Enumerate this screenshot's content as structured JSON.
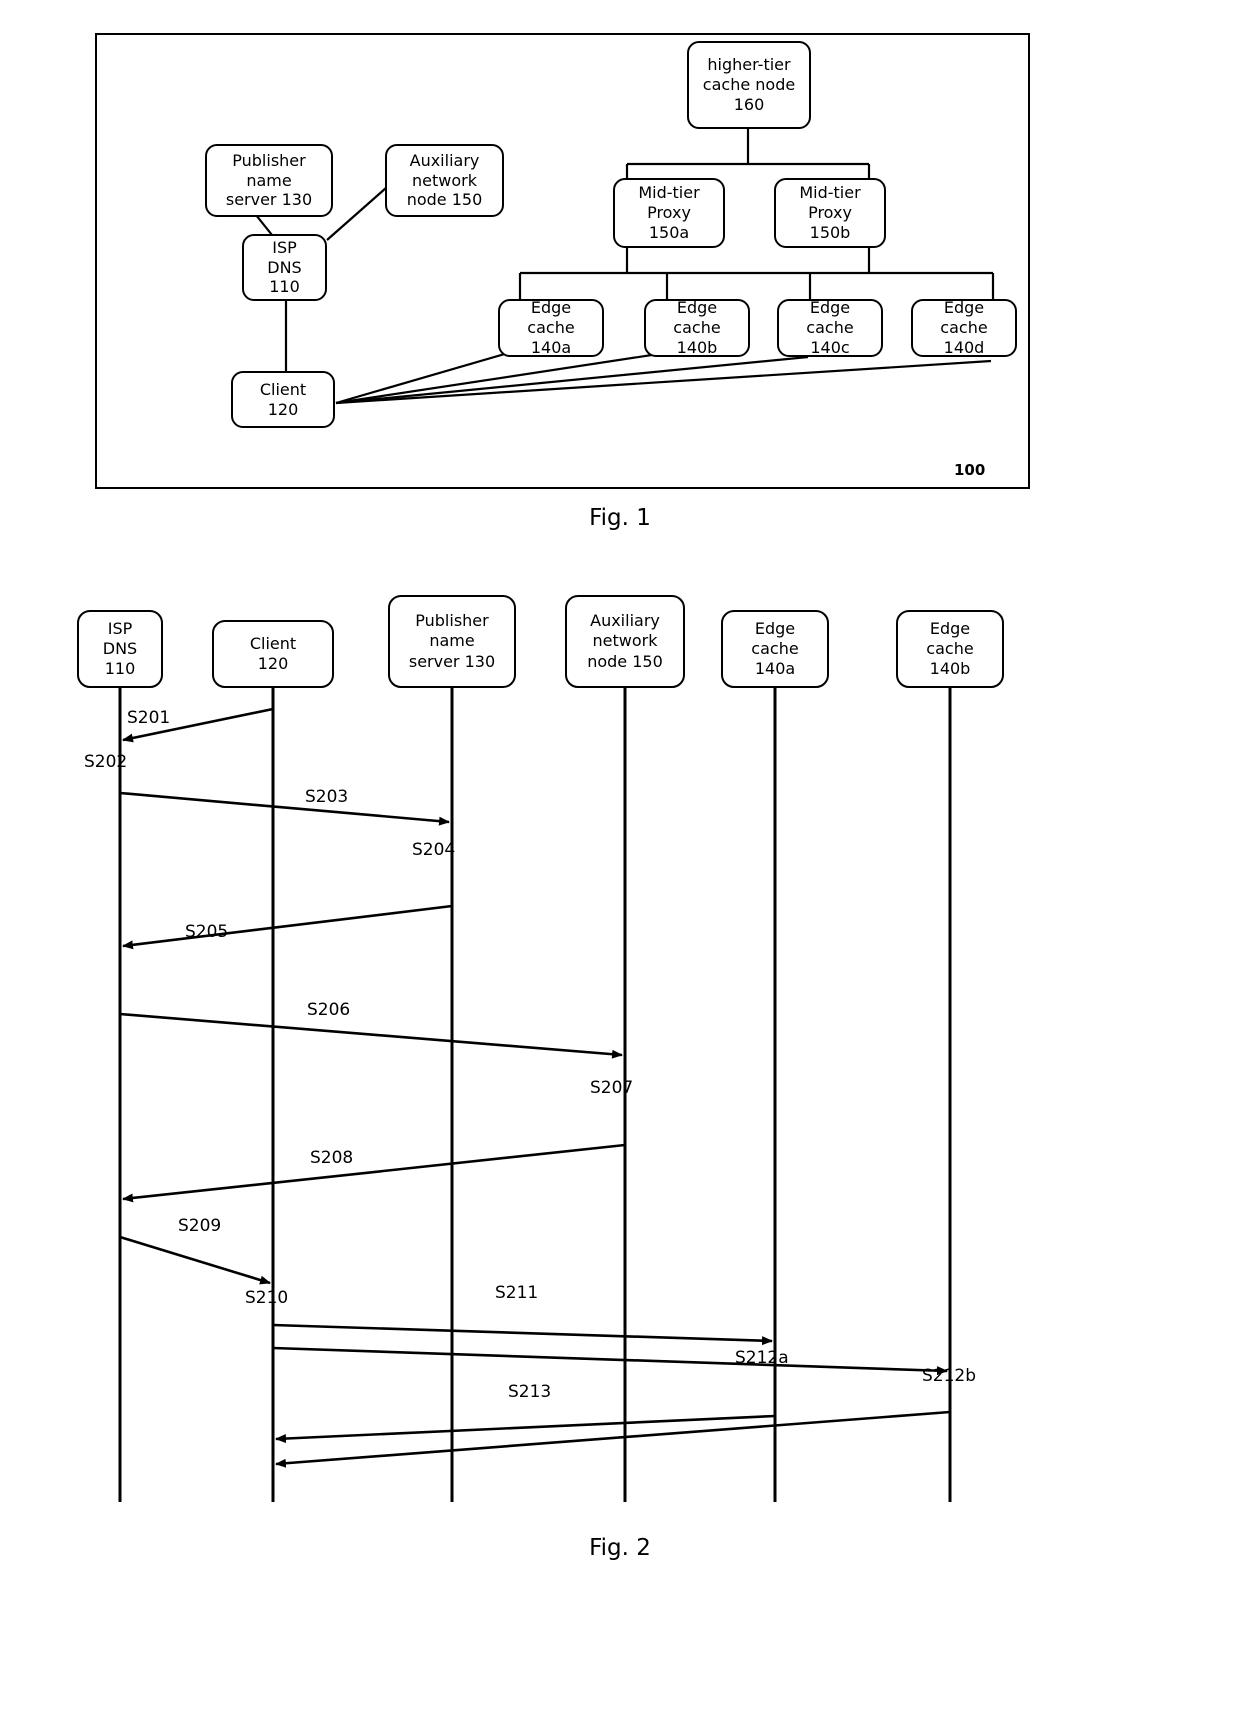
{
  "figures": [
    {
      "id": "fig1",
      "caption": "Fig. 1",
      "reference_numeral": "100",
      "nodes": {
        "publisher_name_server": {
          "lines": [
            "Publisher",
            "name",
            "server 130"
          ]
        },
        "auxiliary_network_node": {
          "lines": [
            "Auxiliary",
            "network",
            "node 150"
          ]
        },
        "isp_dns": {
          "lines": [
            "ISP",
            "DNS",
            "110"
          ]
        },
        "client": {
          "lines": [
            "Client",
            "120"
          ]
        },
        "higher_tier_cache_node": {
          "lines": [
            "higher-tier",
            "cache node",
            "160"
          ]
        },
        "mid_tier_proxy_a": {
          "lines": [
            "Mid-tier",
            "Proxy",
            "150a"
          ]
        },
        "mid_tier_proxy_b": {
          "lines": [
            "Mid-tier",
            "Proxy",
            "150b"
          ]
        },
        "edge_cache_a": {
          "lines": [
            "Edge",
            "cache",
            "140a"
          ]
        },
        "edge_cache_b": {
          "lines": [
            "Edge",
            "cache",
            "140b"
          ]
        },
        "edge_cache_c": {
          "lines": [
            "Edge",
            "cache",
            "140c"
          ]
        },
        "edge_cache_d": {
          "lines": [
            "Edge",
            "cache",
            "140d"
          ]
        }
      }
    },
    {
      "id": "fig2",
      "caption": "Fig. 2",
      "lifelines": [
        {
          "key": "isp_dns",
          "lines": [
            "ISP",
            "DNS",
            "110"
          ]
        },
        {
          "key": "client",
          "lines": [
            "Client",
            "120"
          ]
        },
        {
          "key": "publisher_ns",
          "lines": [
            "Publisher",
            "name",
            "server 130"
          ]
        },
        {
          "key": "aux_node",
          "lines": [
            "Auxiliary",
            "network",
            "node 150"
          ]
        },
        {
          "key": "edge_cache_a",
          "lines": [
            "Edge",
            "cache",
            "140a"
          ]
        },
        {
          "key": "edge_cache_b",
          "lines": [
            "Edge",
            "cache",
            "140b"
          ]
        }
      ],
      "messages": [
        {
          "id": "S201",
          "label": "S201",
          "from": "client",
          "to": "isp_dns"
        },
        {
          "id": "S202",
          "label": "S202",
          "from": "isp_dns",
          "to": "isp_dns"
        },
        {
          "id": "S203",
          "label": "S203",
          "from": "isp_dns",
          "to": "publisher_ns"
        },
        {
          "id": "S204",
          "label": "S204",
          "from": "publisher_ns",
          "to": "publisher_ns"
        },
        {
          "id": "S205",
          "label": "S205",
          "from": "publisher_ns",
          "to": "isp_dns"
        },
        {
          "id": "S206",
          "label": "S206",
          "from": "isp_dns",
          "to": "aux_node"
        },
        {
          "id": "S207",
          "label": "S207",
          "from": "aux_node",
          "to": "aux_node"
        },
        {
          "id": "S208",
          "label": "S208",
          "from": "aux_node",
          "to": "isp_dns"
        },
        {
          "id": "S209",
          "label": "S209",
          "from": "isp_dns",
          "to": "client"
        },
        {
          "id": "S210",
          "label": "S210",
          "from": "client",
          "to": "client"
        },
        {
          "id": "S211",
          "label": "S211",
          "from": "client",
          "to": "edge_cache_a"
        },
        {
          "id": "S212a",
          "label": "S212a",
          "from": "client",
          "to": "edge_cache_b"
        },
        {
          "id": "S212b",
          "label": "S212b",
          "from": "edge_cache_b",
          "to": "client"
        },
        {
          "id": "S213",
          "label": "S213",
          "from": "edge_cache_a",
          "to": "client"
        }
      ]
    }
  ],
  "colors": {
    "ink": "#000000",
    "paper": "#ffffff"
  }
}
